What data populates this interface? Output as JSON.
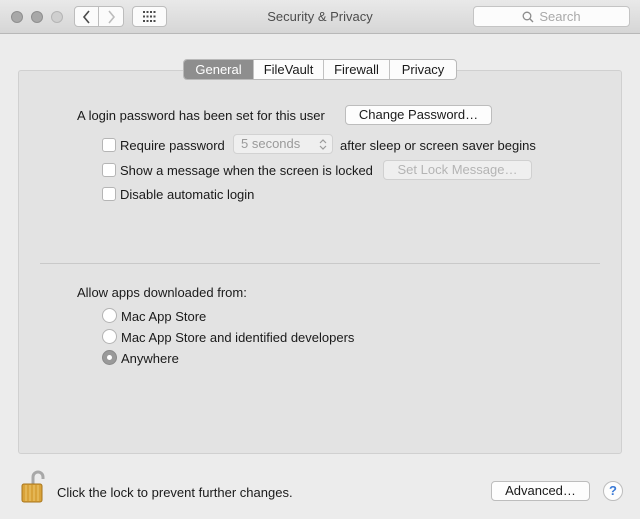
{
  "window": {
    "title": "Security & Privacy",
    "search_placeholder": "Search"
  },
  "toolbar": {
    "back_icon": "chevron-left-icon",
    "forward_icon": "chevron-right-icon",
    "show_all_icon": "grid-icon"
  },
  "tabs": [
    {
      "label": "General",
      "selected": true
    },
    {
      "label": "FileVault",
      "selected": false
    },
    {
      "label": "Firewall",
      "selected": false
    },
    {
      "label": "Privacy",
      "selected": false
    }
  ],
  "general": {
    "login_password_text": "A login password has been set for this user",
    "change_password_label": "Change Password…",
    "require_password": {
      "label": "Require password",
      "checked": false,
      "select_value": "5 seconds",
      "suffix": "after sleep or screen saver begins"
    },
    "show_message": {
      "label": "Show a message when the screen is locked",
      "checked": false,
      "button_label": "Set Lock Message…"
    },
    "disable_auto_login": {
      "label": "Disable automatic login",
      "checked": false
    },
    "allow_apps_label": "Allow apps downloaded from:",
    "allow_options": [
      {
        "label": "Mac App Store",
        "selected": false
      },
      {
        "label": "Mac App Store and identified developers",
        "selected": false
      },
      {
        "label": "Anywhere",
        "selected": true
      }
    ]
  },
  "footer": {
    "lock_text": "Click the lock to prevent further changes.",
    "advanced_label": "Advanced…",
    "help_label": "?"
  },
  "colors": {
    "window_bg": "#ececec",
    "panel_bg": "#e3e3e3",
    "selected_tab_bg": "#8e8e8e",
    "help_blue": "#3b7ad6",
    "lock_gold": "#d9a33a"
  }
}
